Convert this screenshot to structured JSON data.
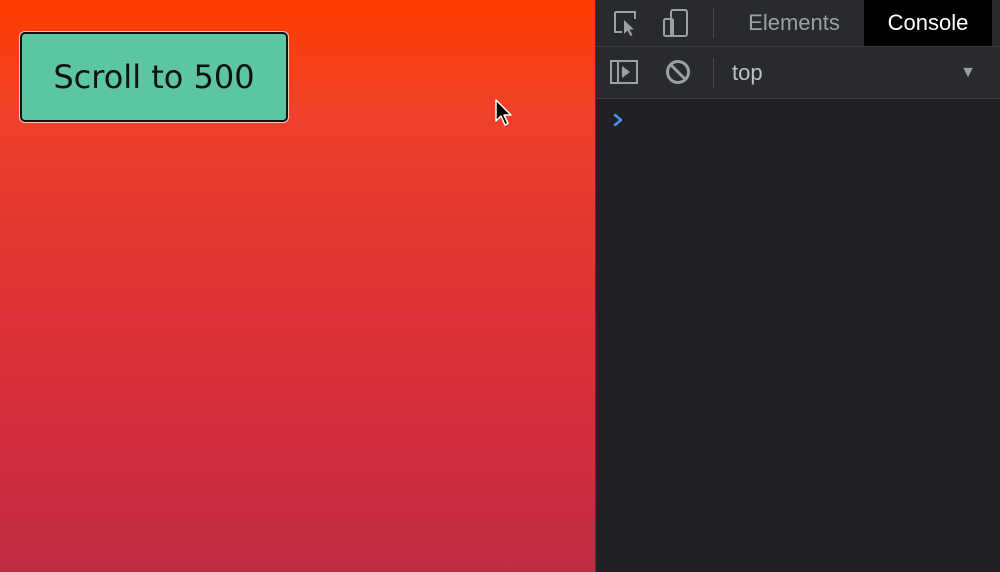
{
  "page": {
    "scroll_button_label": "Scroll to 500",
    "gradient_colors": [
      "#ff3d00",
      "#c02b45"
    ],
    "button_color": "#5cc6a0"
  },
  "devtools": {
    "tabs": [
      {
        "label": "Elements",
        "active": false
      },
      {
        "label": "Console",
        "active": true
      }
    ],
    "toolbar_icons": [
      "inspect-element-icon",
      "device-toolbar-icon"
    ],
    "console_toolbar_icons": [
      "sidebar-toggle-icon",
      "clear-console-icon"
    ],
    "context": {
      "selected": "top"
    },
    "prompt_value": "",
    "prompt_color": "#4d8bf5"
  }
}
